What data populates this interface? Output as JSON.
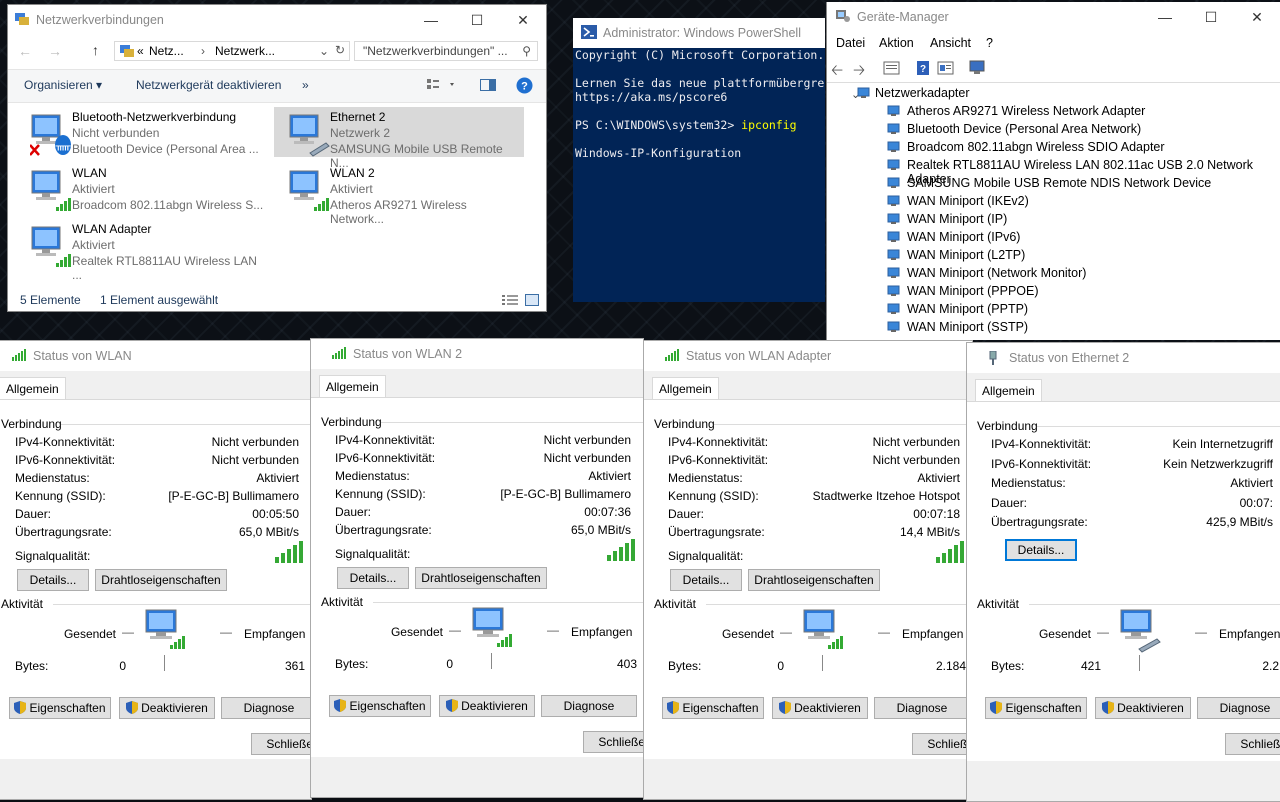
{
  "explorer": {
    "title": "Netzwerkverbindungen",
    "addr_seg1": "Netz...",
    "addr_seg2": "Netzwerk...",
    "addr_prefix": "«",
    "search_placeholder": "\"Netzwerkverbindungen\" ...",
    "cmd_organize": "Organisieren",
    "cmd_disable": "Netzwerkgerät deaktivieren",
    "cmd_more": "»",
    "items": [
      {
        "name": "Bluetooth-Netzwerkverbindung",
        "status": "Nicht verbunden",
        "device": "Bluetooth Device (Personal Area ..."
      },
      {
        "name": "Ethernet 2",
        "status": "Netzwerk 2",
        "device": "SAMSUNG Mobile USB Remote N..."
      },
      {
        "name": "WLAN",
        "status": "Aktiviert",
        "device": "Broadcom 802.11abgn Wireless S..."
      },
      {
        "name": "WLAN 2",
        "status": "Aktiviert",
        "device": "Atheros AR9271 Wireless Network..."
      },
      {
        "name": "WLAN Adapter",
        "status": "Aktiviert",
        "device": "Realtek RTL8811AU Wireless LAN ..."
      }
    ],
    "status_count": "5 Elemente",
    "status_selected": "1 Element ausgewählt"
  },
  "powershell": {
    "title": "Administrator: Windows PowerShell",
    "line1": "Copyright (C) Microsoft Corporation.",
    "line2": "Lernen Sie das neue plattformübergre",
    "line3": "https://aka.ms/pscore6",
    "prompt": "PS C:\\WINDOWS\\system32> ",
    "command": "ipconfig",
    "line5": "Windows-IP-Konfiguration"
  },
  "devmgr": {
    "title": "Geräte-Manager",
    "menu": [
      "Datei",
      "Aktion",
      "Ansicht",
      "?"
    ],
    "category": "Netzwerkadapter",
    "devices": [
      "Atheros AR9271 Wireless Network Adapter",
      "Bluetooth Device (Personal Area Network)",
      "Broadcom 802.11abgn Wireless SDIO Adapter",
      "Realtek RTL8811AU Wireless LAN 802.11ac USB 2.0 Network Adapter",
      "SAMSUNG Mobile USB Remote NDIS Network Device",
      "WAN Miniport (IKEv2)",
      "WAN Miniport (IP)",
      "WAN Miniport (IPv6)",
      "WAN Miniport (L2TP)",
      "WAN Miniport (Network Monitor)",
      "WAN Miniport (PPPOE)",
      "WAN Miniport (PPTP)",
      "WAN Miniport (SSTP)"
    ]
  },
  "labels": {
    "tab": "Allgemein",
    "connection": "Verbindung",
    "ipv4": "IPv4-Konnektivität:",
    "ipv6": "IPv6-Konnektivität:",
    "media": "Medienstatus:",
    "ssid": "Kennung (SSID):",
    "duration": "Dauer:",
    "rate": "Übertragungsrate:",
    "signal": "Signalqualität:",
    "details": "Details...",
    "wireless_props": "Drahtloseigenschaften",
    "activity": "Aktivität",
    "sent": "Gesendet",
    "received": "Empfangen",
    "bytes": "Bytes:",
    "properties": "Eigenschaften",
    "deactivate": "Deaktivieren",
    "diagnose": "Diagnose",
    "close": "Schließen"
  },
  "dialogs": {
    "wlan": {
      "title": "Status von WLAN",
      "ipv4": "Nicht verbunden",
      "ipv6": "Nicht verbunden",
      "media": "Aktiviert",
      "ssid": "[P-E-GC-B] Bullimamero",
      "duration": "00:05:50",
      "rate": "65,0 MBit/s",
      "signal_bars": 5,
      "bytes_sent": "0",
      "bytes_received": "361"
    },
    "wlan2": {
      "title": "Status von WLAN 2",
      "ipv4": "Nicht verbunden",
      "ipv6": "Nicht verbunden",
      "media": "Aktiviert",
      "ssid": "[P-E-GC-B] Bullimamero",
      "duration": "00:07:36",
      "rate": "65,0 MBit/s",
      "signal_bars": 5,
      "bytes_sent": "0",
      "bytes_received": "403"
    },
    "wlanadapter": {
      "title": "Status von WLAN Adapter",
      "ipv4": "Nicht verbunden",
      "ipv6": "Nicht verbunden",
      "media": "Aktiviert",
      "ssid": "Stadtwerke Itzehoe Hotspot",
      "duration": "00:07:18",
      "rate": "14,4 MBit/s",
      "signal_bars": 5,
      "bytes_sent": "0",
      "bytes_received": "2.184"
    },
    "ethernet2": {
      "title": "Status von Ethernet 2",
      "ipv4": "Kein Internetzugriff",
      "ipv6": "Kein Netzwerkzugriff",
      "media": "Aktiviert",
      "duration": "00:07:",
      "rate": "425,9 MBit/s",
      "bytes_sent": "421",
      "bytes_received": "2.2"
    }
  }
}
